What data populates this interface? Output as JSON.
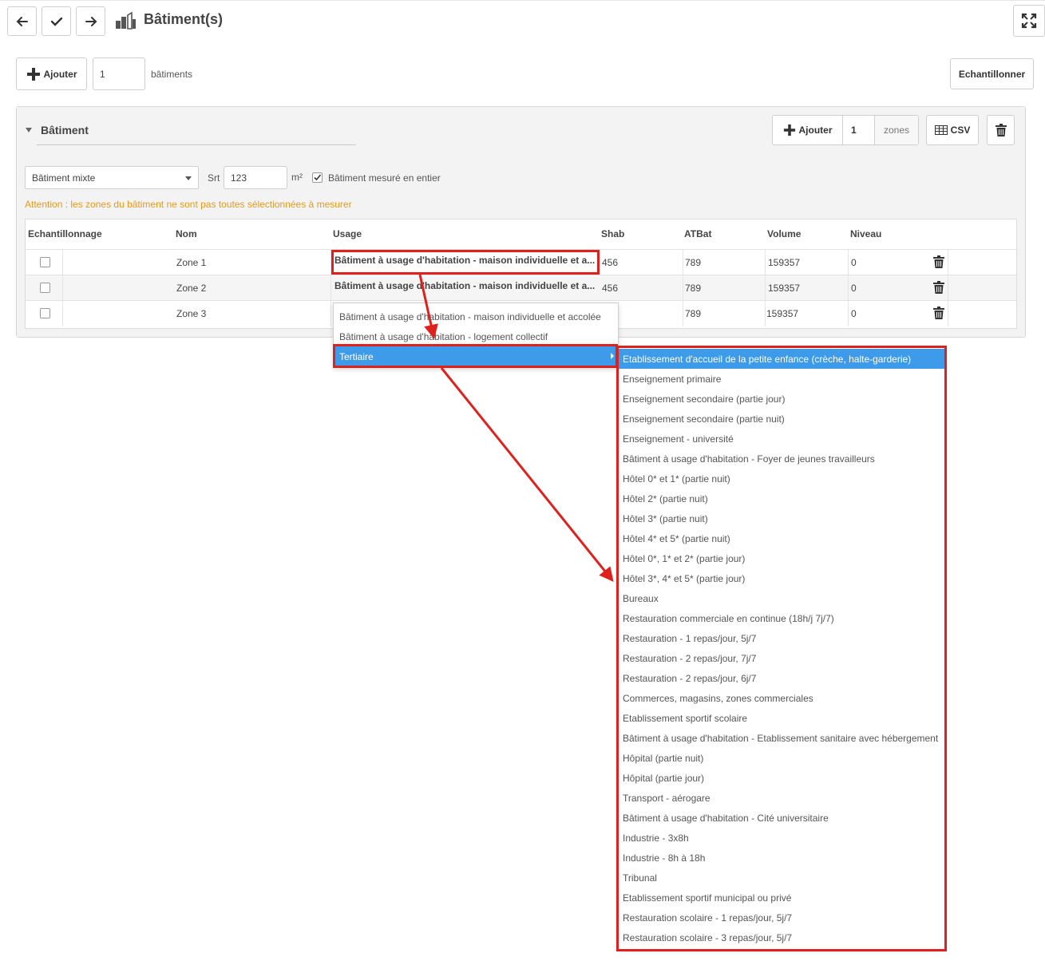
{
  "header": {
    "title": "Bâtiment(s)",
    "add_label": "Ajouter",
    "count_value": "1",
    "count_unit": "bâtiments",
    "sample_label": "Echantillonner"
  },
  "panel": {
    "title": "Bâtiment",
    "add_label": "Ajouter",
    "zones_count": "1",
    "zones_unit": "zones",
    "csv_label": "CSV",
    "building_type": "Bâtiment mixte",
    "srt_label": "Srt",
    "srt_value": "123",
    "srt_unit": "m²",
    "measured_label": "Bâtiment mesuré en entier",
    "warning": "Attention : les zones du bâtiment ne sont pas toutes sélectionnées à mesurer"
  },
  "table": {
    "headers": {
      "echantillonnage": "Echantillonnage",
      "nom": "Nom",
      "usage": "Usage",
      "shab": "Shab",
      "atbat": "ATBat",
      "volume": "Volume",
      "niveau": "Niveau"
    },
    "rows": [
      {
        "nom": "Zone 1",
        "usage": "Bâtiment à usage d'habitation - maison individuelle et a...",
        "shab": "456",
        "atbat": "789",
        "volume": "159357",
        "niveau": "0"
      },
      {
        "nom": "Zone 2",
        "usage": "Bâtiment à usage d'habitation - maison individuelle et a...",
        "shab": "456",
        "atbat": "789",
        "volume": "159357",
        "niveau": "0"
      },
      {
        "nom": "Zone 3",
        "usage": "",
        "shab": "",
        "atbat": "789",
        "volume": "159357",
        "niveau": "0"
      }
    ]
  },
  "dropdown": {
    "items": [
      "Bâtiment à usage d'habitation - maison individuelle et accolée",
      "Bâtiment à usage d'habitation - logement collectif",
      "Tertiaire"
    ]
  },
  "submenu": {
    "items": [
      "Etablissement d'accueil de la petite enfance (crèche, halte-garderie)",
      "Enseignement primaire",
      "Enseignement secondaire (partie jour)",
      "Enseignement secondaire (partie nuit)",
      "Enseignement - université",
      "Bâtiment à usage d'habitation - Foyer de jeunes travailleurs",
      "Hôtel 0* et 1* (partie nuit)",
      "Hôtel 2* (partie nuit)",
      "Hôtel 3* (partie nuit)",
      "Hôtel 4* et 5* (partie nuit)",
      "Hôtel 0*, 1* et 2* (partie jour)",
      "Hôtel 3*, 4* et 5* (partie jour)",
      "Bureaux",
      "Restauration commerciale en continue (18h/j 7j/7)",
      "Restauration - 1 repas/jour, 5j/7",
      "Restauration - 2 repas/jour, 7j/7",
      "Restauration - 2 repas/jour, 6j/7",
      "Commerces, magasins, zones commerciales",
      "Etablissement sportif scolaire",
      "Bâtiment à usage d'habitation - Etablissement sanitaire avec hébergement",
      "Hôpital (partie nuit)",
      "Hôpital (partie jour)",
      "Transport - aérogare",
      "Bâtiment à usage d'habitation - Cité universitaire",
      "Industrie - 3x8h",
      "Industrie - 8h à 18h",
      "Tribunal",
      "Etablissement sportif municipal ou privé",
      "Restauration scolaire - 1 repas/jour, 5j/7",
      "Restauration scolaire - 3 repas/jour, 5j/7"
    ]
  },
  "colors": {
    "accent": "#3d9be9",
    "warning": "#e69a1a",
    "highlight": "#e0201d"
  },
  "icons": [
    "arrow-left-icon",
    "check-icon",
    "arrow-right-icon",
    "building-icon",
    "fullscreen-icon",
    "plus-icon",
    "table-icon",
    "trash-icon"
  ]
}
